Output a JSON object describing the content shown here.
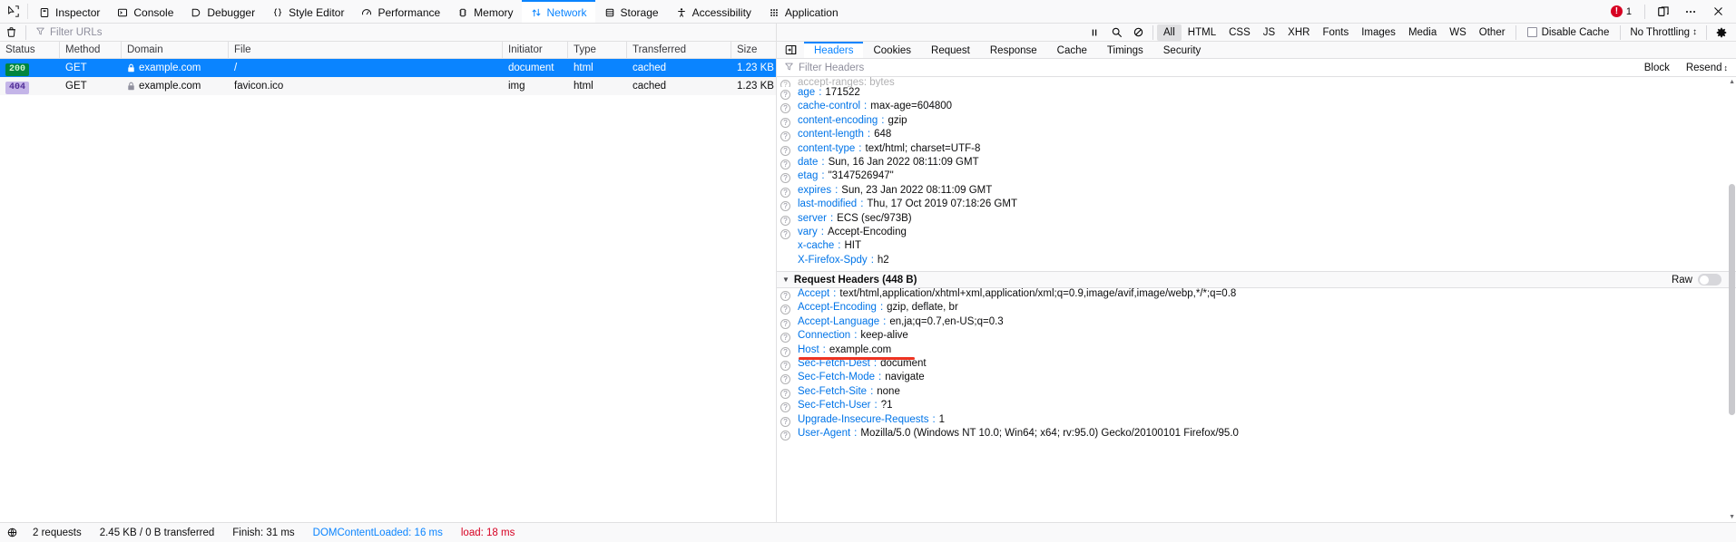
{
  "devtools": {
    "picker_icon": "element-picker-icon",
    "tabs": [
      {
        "label": "Inspector",
        "icon": "inspector-icon",
        "selected": false
      },
      {
        "label": "Console",
        "icon": "console-icon",
        "selected": false
      },
      {
        "label": "Debugger",
        "icon": "debugger-icon",
        "selected": false
      },
      {
        "label": "Style Editor",
        "icon": "style-editor-icon",
        "selected": false
      },
      {
        "label": "Performance",
        "icon": "performance-icon",
        "selected": false
      },
      {
        "label": "Memory",
        "icon": "memory-icon",
        "selected": false
      },
      {
        "label": "Network",
        "icon": "network-icon",
        "selected": true
      },
      {
        "label": "Storage",
        "icon": "storage-icon",
        "selected": false
      },
      {
        "label": "Accessibility",
        "icon": "accessibility-icon",
        "selected": false
      },
      {
        "label": "Application",
        "icon": "application-icon",
        "selected": false
      }
    ],
    "error_count": "1",
    "responsive_icon": "responsive-design-mode-icon",
    "meatball_icon": "more-options-icon",
    "close_icon": "close-icon"
  },
  "network_toolbar": {
    "clear_icon": "trash-icon",
    "filter_placeholder": "Filter URLs",
    "filter_value": "",
    "pause_icon": "pause-icon",
    "search_icon": "search-icon",
    "block_icon": "block-icon",
    "type_filters": [
      {
        "label": "All",
        "active": true
      },
      {
        "label": "HTML",
        "active": false
      },
      {
        "label": "CSS",
        "active": false
      },
      {
        "label": "JS",
        "active": false
      },
      {
        "label": "XHR",
        "active": false
      },
      {
        "label": "Fonts",
        "active": false
      },
      {
        "label": "Images",
        "active": false
      },
      {
        "label": "Media",
        "active": false
      },
      {
        "label": "WS",
        "active": false
      },
      {
        "label": "Other",
        "active": false
      }
    ],
    "disable_cache_label": "Disable Cache",
    "disable_cache_checked": false,
    "throttling_label": "No Throttling",
    "throttling_caret": "↕",
    "settings_icon": "gear-icon"
  },
  "requests_table": {
    "columns": [
      "Status",
      "Method",
      "Domain",
      "File",
      "Initiator",
      "Type",
      "Transferred",
      "Size"
    ],
    "rows": [
      {
        "status": "200",
        "status_kind": "ok",
        "method": "GET",
        "domain": "example.com",
        "secure": true,
        "file": "/",
        "initiator": "document",
        "type": "html",
        "transferred": "cached",
        "size": "1.23 KB",
        "selected": true
      },
      {
        "status": "404",
        "status_kind": "notfound",
        "method": "GET",
        "domain": "example.com",
        "secure": true,
        "file": "favicon.ico",
        "initiator": "img",
        "type": "html",
        "transferred": "cached",
        "size": "1.23 KB",
        "selected": false
      }
    ]
  },
  "statusbar": {
    "network_icon": "network-status-icon",
    "requests": "2 requests",
    "transferred": "2.45 KB / 0 B transferred",
    "finish": "Finish: 31 ms",
    "dom_content_loaded": "DOMContentLoaded: 16 ms",
    "load": "load: 18 ms"
  },
  "details": {
    "panel_toggle_icon": "toggle-sidebar-icon",
    "tabs": [
      {
        "label": "Headers",
        "selected": true
      },
      {
        "label": "Cookies",
        "selected": false
      },
      {
        "label": "Request",
        "selected": false
      },
      {
        "label": "Response",
        "selected": false
      },
      {
        "label": "Cache",
        "selected": false
      },
      {
        "label": "Timings",
        "selected": false
      },
      {
        "label": "Security",
        "selected": false
      }
    ],
    "filter_placeholder": "Filter Headers",
    "filter_value": "",
    "block_label": "Block",
    "resend_label": "Resend",
    "resend_caret": "↕",
    "clipped_row": "accept-ranges: bytes",
    "response_headers": [
      {
        "name": "age",
        "value": "171522",
        "help": true
      },
      {
        "name": "cache-control",
        "value": "max-age=604800",
        "help": true
      },
      {
        "name": "content-encoding",
        "value": "gzip",
        "help": true
      },
      {
        "name": "content-length",
        "value": "648",
        "help": true
      },
      {
        "name": "content-type",
        "value": "text/html; charset=UTF-8",
        "help": true
      },
      {
        "name": "date",
        "value": "Sun, 16 Jan 2022 08:11:09 GMT",
        "help": true
      },
      {
        "name": "etag",
        "value": "\"3147526947\"",
        "help": true
      },
      {
        "name": "expires",
        "value": "Sun, 23 Jan 2022 08:11:09 GMT",
        "help": true
      },
      {
        "name": "last-modified",
        "value": "Thu, 17 Oct 2019 07:18:26 GMT",
        "help": true
      },
      {
        "name": "server",
        "value": "ECS (sec/973B)",
        "help": true
      },
      {
        "name": "vary",
        "value": "Accept-Encoding",
        "help": true
      },
      {
        "name": "x-cache",
        "value": "HIT",
        "help": false
      },
      {
        "name": "X-Firefox-Spdy",
        "value": "h2",
        "help": false
      }
    ],
    "request_section_title": "Request Headers (448 B)",
    "raw_label": "Raw",
    "raw_enabled": false,
    "request_headers": [
      {
        "name": "Accept",
        "value": "text/html,application/xhtml+xml,application/xml;q=0.9,image/avif,image/webp,*/*;q=0.8",
        "help": true
      },
      {
        "name": "Accept-Encoding",
        "value": "gzip, deflate, br",
        "help": true
      },
      {
        "name": "Accept-Language",
        "value": "en,ja;q=0.7,en-US;q=0.3",
        "help": true
      },
      {
        "name": "Connection",
        "value": "keep-alive",
        "help": true
      },
      {
        "name": "Host",
        "value": "example.com",
        "help": true
      },
      {
        "name": "Sec-Fetch-Dest",
        "value": "document",
        "help": true
      },
      {
        "name": "Sec-Fetch-Mode",
        "value": "navigate",
        "help": true
      },
      {
        "name": "Sec-Fetch-Site",
        "value": "none",
        "help": true
      },
      {
        "name": "Sec-Fetch-User",
        "value": "?1",
        "help": true
      },
      {
        "name": "Upgrade-Insecure-Requests",
        "value": "1",
        "help": true
      },
      {
        "name": "User-Agent",
        "value": "Mozilla/5.0 (Windows NT 10.0; Win64; x64; rv:95.0) Gecko/20100101 Firefox/95.0",
        "help": true
      }
    ]
  },
  "colors": {
    "accent": "#0a84ff",
    "header_name": "#0074e8",
    "status_ok_bg": "#00853f",
    "status_404_bg": "#c4b5e8",
    "error_red": "#d70022",
    "annotation_red": "#ee3322"
  }
}
